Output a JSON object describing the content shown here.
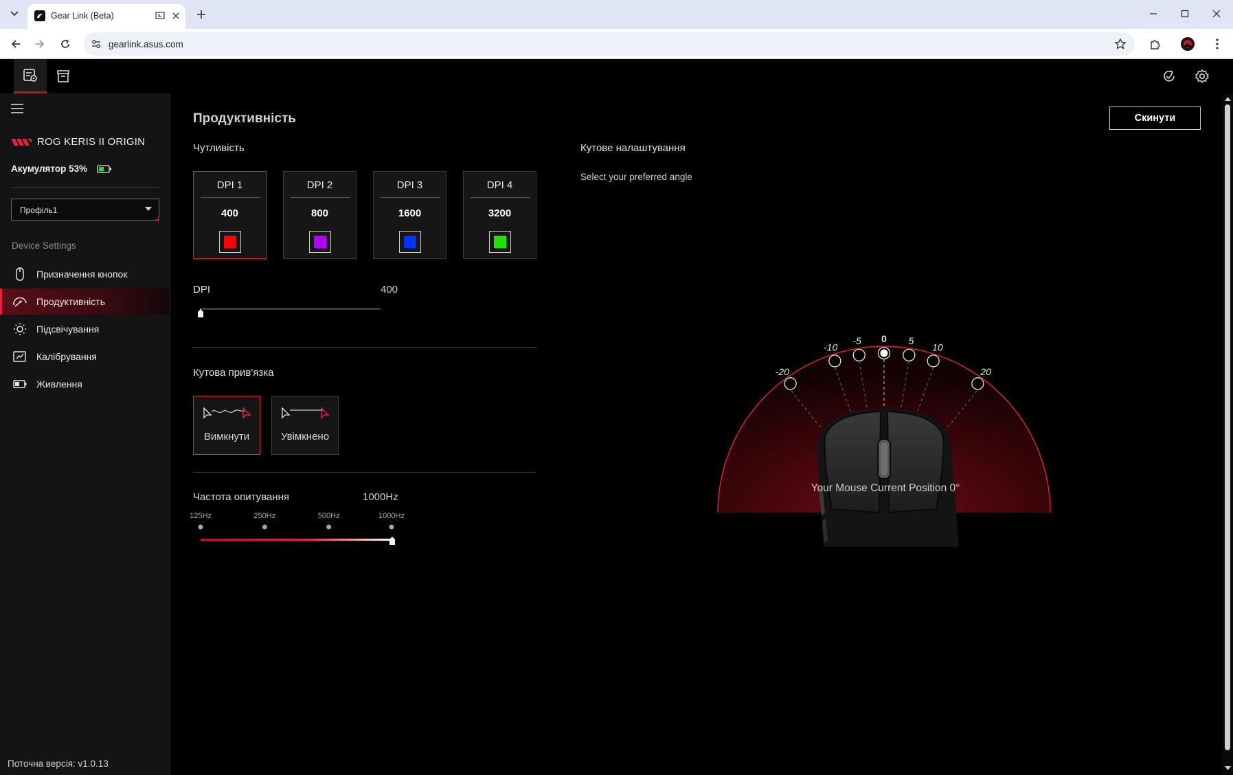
{
  "browser": {
    "tab_title": "Gear Link (Beta)",
    "url": "gearlink.asus.com"
  },
  "sidebar": {
    "device_name": "ROG KERIS II ORIGIN",
    "battery_label": "Акумулятор 53%",
    "battery_percent": 53,
    "profile": "Профіль1",
    "section_label": "Device Settings",
    "items": [
      {
        "label": "Призначення кнопок",
        "icon": "mouse-icon",
        "active": false
      },
      {
        "label": "Продуктивність",
        "icon": "performance-icon",
        "active": true
      },
      {
        "label": "Підсвічування",
        "icon": "lighting-icon",
        "active": false
      },
      {
        "label": "Калібрування",
        "icon": "calibration-icon",
        "active": false
      },
      {
        "label": "Живлення",
        "icon": "power-icon",
        "active": false
      }
    ],
    "version": "Поточна версія: v1.0.13"
  },
  "main": {
    "title": "Продуктивність",
    "reset_label": "Скинути",
    "sensitivity": {
      "title": "Чутливість",
      "dpi_stages": [
        {
          "name": "DPI 1",
          "value": "400",
          "color": "#ff0000",
          "selected": true
        },
        {
          "name": "DPI 2",
          "value": "800",
          "color": "#b400ff",
          "selected": false
        },
        {
          "name": "DPI 3",
          "value": "1600",
          "color": "#0033ff",
          "selected": false
        },
        {
          "name": "DPI 4",
          "value": "3200",
          "color": "#22e000",
          "selected": false
        }
      ],
      "dpi_label": "DPI",
      "dpi_value": "400",
      "dpi_slider_fraction": 0.0
    },
    "angle_snapping": {
      "title": "Кутова прив'язка",
      "options": [
        {
          "label": "Вимкнути",
          "selected": true
        },
        {
          "label": "Увімкнено",
          "selected": false
        }
      ]
    },
    "polling": {
      "title": "Частота опитування",
      "value": "1000Hz",
      "options": [
        "125Hz",
        "250Hz",
        "500Hz",
        "1000Hz"
      ],
      "selected_index": 3
    },
    "angle_tuning": {
      "title": "Кутове налаштування",
      "subtitle": "Select your preferred angle",
      "angle_options": [
        "-20",
        "-10",
        "-5",
        "0",
        "5",
        "10",
        "20"
      ],
      "selected": "0",
      "caption": "Your Mouse Current Position 0°"
    }
  },
  "colors": {
    "accent": "#e3223b",
    "background": "#000000",
    "sidebar_bg": "#141414"
  }
}
